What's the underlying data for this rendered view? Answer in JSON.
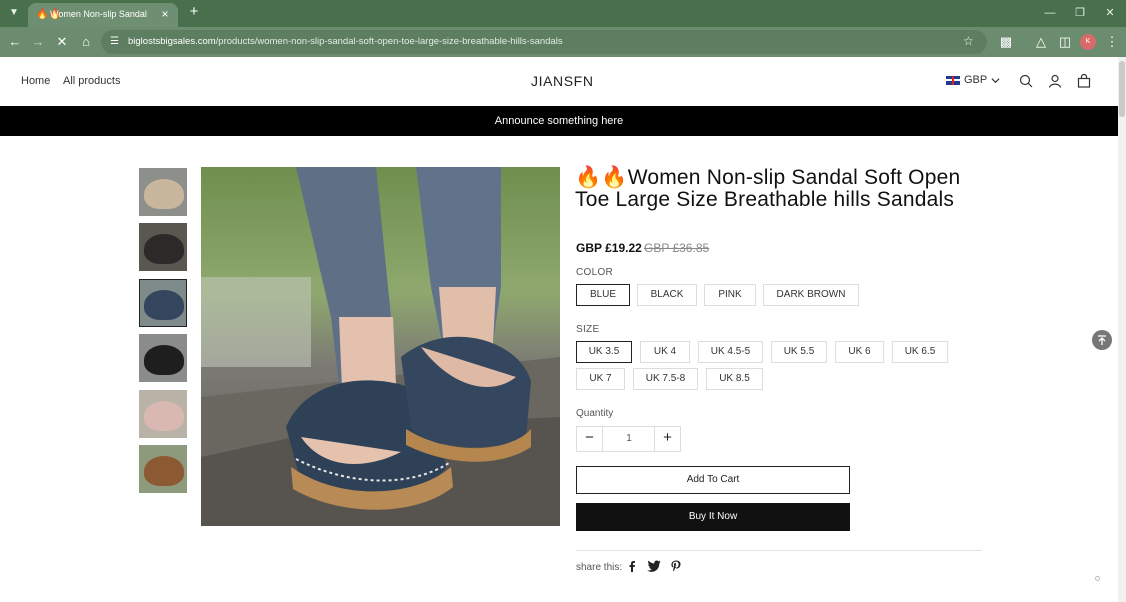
{
  "browser": {
    "tab_title": "Women Non-slip Sandal",
    "tab_favicon": "🔥🔥",
    "url_host": "biglostsbigsales.com",
    "url_path": "/products/women-non-slip-sandal-soft-open-toe-large-size-breathable-hills-sandals",
    "profile_initials": "K"
  },
  "header": {
    "nav": [
      "Home",
      "All products"
    ],
    "logo": "JIANSFN",
    "currency": "GBP"
  },
  "announcement": "Announce something here",
  "product": {
    "title": "🔥🔥Women Non-slip Sandal Soft Open Toe Large Size Breathable hills Sandals",
    "price": "GBP £19.22",
    "compare_price": "GBP £36.85",
    "color_label": "COLOR",
    "colors": [
      "BLUE",
      "BLACK",
      "PINK",
      "DARK BROWN"
    ],
    "selected_color": "BLUE",
    "size_label": "SIZE",
    "sizes": [
      "UK 3.5",
      "UK 4",
      "UK 4.5-5",
      "UK 5.5",
      "UK 6",
      "UK 6.5",
      "UK 7",
      "UK 7.5-8",
      "UK 8.5"
    ],
    "selected_size": "UK 3.5",
    "quantity_label": "Quantity",
    "quantity": "1",
    "add_to_cart": "Add To Cart",
    "buy_now": "Buy It Now",
    "share_label": "share this:"
  },
  "gallery": {
    "thumbnail_count": 6,
    "active_index": 2
  },
  "colors": {
    "chrome_dark": "#48704d",
    "chrome_toolbar": "#6b8c6e",
    "announcement_bg": "#000000",
    "buy_button_bg": "#111111"
  }
}
